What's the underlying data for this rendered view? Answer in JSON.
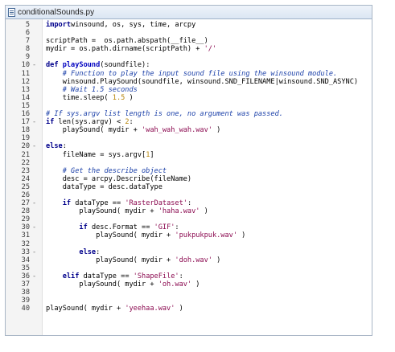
{
  "window": {
    "title": "conditionalSounds.py"
  },
  "lines": [
    {
      "n": "5",
      "fold": "",
      "tokens": [
        [
          "kw",
          "import"
        ],
        [
          "",
          "winsound, os, sys, time, arcpy"
        ]
      ]
    },
    {
      "n": "6",
      "fold": "",
      "tokens": []
    },
    {
      "n": "7",
      "fold": "",
      "tokens": [
        [
          "",
          "scriptPath =  os.path.abspath(__file__)"
        ]
      ]
    },
    {
      "n": "8",
      "fold": "",
      "tokens": [
        [
          "",
          "mydir = os.path.dirname(scriptPath) + "
        ],
        [
          "str",
          "'/'"
        ]
      ]
    },
    {
      "n": "9",
      "fold": "",
      "tokens": []
    },
    {
      "n": "10",
      "fold": "-",
      "tokens": [
        [
          "kw",
          "def "
        ],
        [
          "fn",
          "playSound"
        ],
        [
          "",
          "(soundfile):"
        ]
      ]
    },
    {
      "n": "11",
      "fold": "",
      "tokens": [
        [
          "",
          "    "
        ],
        [
          "cmt",
          "# Function to play the input sound file using the winsound module."
        ]
      ]
    },
    {
      "n": "12",
      "fold": "",
      "tokens": [
        [
          "",
          "    winsound.PlaySound(soundfile, winsound.SND_FILENAME|winsound.SND_ASYNC)"
        ]
      ]
    },
    {
      "n": "13",
      "fold": "",
      "tokens": [
        [
          "",
          "    "
        ],
        [
          "cmt",
          "# Wait 1.5 seconds"
        ]
      ]
    },
    {
      "n": "14",
      "fold": "",
      "tokens": [
        [
          "",
          "    time.sleep( "
        ],
        [
          "num",
          "1.5"
        ],
        [
          "",
          " )"
        ]
      ]
    },
    {
      "n": "15",
      "fold": "",
      "tokens": []
    },
    {
      "n": "16",
      "fold": "",
      "tokens": [
        [
          "cmt",
          "# If sys.argv list length is one, no argument was passed."
        ]
      ]
    },
    {
      "n": "17",
      "fold": "-",
      "tokens": [
        [
          "kw",
          "if "
        ],
        [
          "",
          "len(sys.argv) < "
        ],
        [
          "num",
          "2"
        ],
        [
          "",
          ":"
        ]
      ]
    },
    {
      "n": "18",
      "fold": "",
      "tokens": [
        [
          "",
          "    playSound( mydir + "
        ],
        [
          "str",
          "'wah_wah_wah.wav'"
        ],
        [
          "",
          " )"
        ]
      ]
    },
    {
      "n": "19",
      "fold": "",
      "tokens": []
    },
    {
      "n": "20",
      "fold": "-",
      "tokens": [
        [
          "kw",
          "else"
        ],
        [
          "",
          ":"
        ]
      ]
    },
    {
      "n": "21",
      "fold": "",
      "tokens": [
        [
          "",
          "    fileName = sys.argv["
        ],
        [
          "num",
          "1"
        ],
        [
          "",
          "]"
        ]
      ]
    },
    {
      "n": "22",
      "fold": "",
      "tokens": []
    },
    {
      "n": "23",
      "fold": "",
      "tokens": [
        [
          "",
          "    "
        ],
        [
          "cmt",
          "# Get the describe object"
        ]
      ]
    },
    {
      "n": "24",
      "fold": "",
      "tokens": [
        [
          "",
          "    desc = arcpy.Describe(fileName)"
        ]
      ]
    },
    {
      "n": "25",
      "fold": "",
      "tokens": [
        [
          "",
          "    dataType = desc.dataType"
        ]
      ]
    },
    {
      "n": "26",
      "fold": "",
      "tokens": []
    },
    {
      "n": "27",
      "fold": "-",
      "tokens": [
        [
          "",
          "    "
        ],
        [
          "kw",
          "if "
        ],
        [
          "",
          "dataType == "
        ],
        [
          "str",
          "'RasterDataset'"
        ],
        [
          "",
          ":"
        ]
      ]
    },
    {
      "n": "28",
      "fold": "",
      "tokens": [
        [
          "",
          "        playSound( mydir + "
        ],
        [
          "str",
          "'haha.wav'"
        ],
        [
          "",
          " )"
        ]
      ]
    },
    {
      "n": "29",
      "fold": "",
      "tokens": []
    },
    {
      "n": "30",
      "fold": "-",
      "tokens": [
        [
          "",
          "        "
        ],
        [
          "kw",
          "if "
        ],
        [
          "",
          "desc.Format == "
        ],
        [
          "str",
          "'GIF'"
        ],
        [
          "",
          ":"
        ]
      ]
    },
    {
      "n": "31",
      "fold": "",
      "tokens": [
        [
          "",
          "            playSound( mydir + "
        ],
        [
          "str",
          "'pukpukpuk.wav'"
        ],
        [
          "",
          " )"
        ]
      ]
    },
    {
      "n": "32",
      "fold": "",
      "tokens": []
    },
    {
      "n": "33",
      "fold": "-",
      "tokens": [
        [
          "",
          "        "
        ],
        [
          "kw",
          "else"
        ],
        [
          "",
          ":"
        ]
      ]
    },
    {
      "n": "34",
      "fold": "",
      "tokens": [
        [
          "",
          "            playSound( mydir + "
        ],
        [
          "str",
          "'doh.wav'"
        ],
        [
          "",
          " )"
        ]
      ]
    },
    {
      "n": "35",
      "fold": "",
      "tokens": []
    },
    {
      "n": "36",
      "fold": "-",
      "tokens": [
        [
          "",
          "    "
        ],
        [
          "kw",
          "elif "
        ],
        [
          "",
          "dataType == "
        ],
        [
          "str",
          "'ShapeFile'"
        ],
        [
          "",
          ":"
        ]
      ]
    },
    {
      "n": "37",
      "fold": "",
      "tokens": [
        [
          "",
          "        playSound( mydir + "
        ],
        [
          "str",
          "'oh.wav'"
        ],
        [
          "",
          " )"
        ]
      ]
    },
    {
      "n": "38",
      "fold": "",
      "tokens": []
    },
    {
      "n": "39",
      "fold": "",
      "tokens": []
    },
    {
      "n": "40",
      "fold": "",
      "tokens": [
        [
          "",
          "playSound( mydir + "
        ],
        [
          "str",
          "'yeehaa.wav'"
        ],
        [
          "",
          " )"
        ]
      ]
    }
  ]
}
